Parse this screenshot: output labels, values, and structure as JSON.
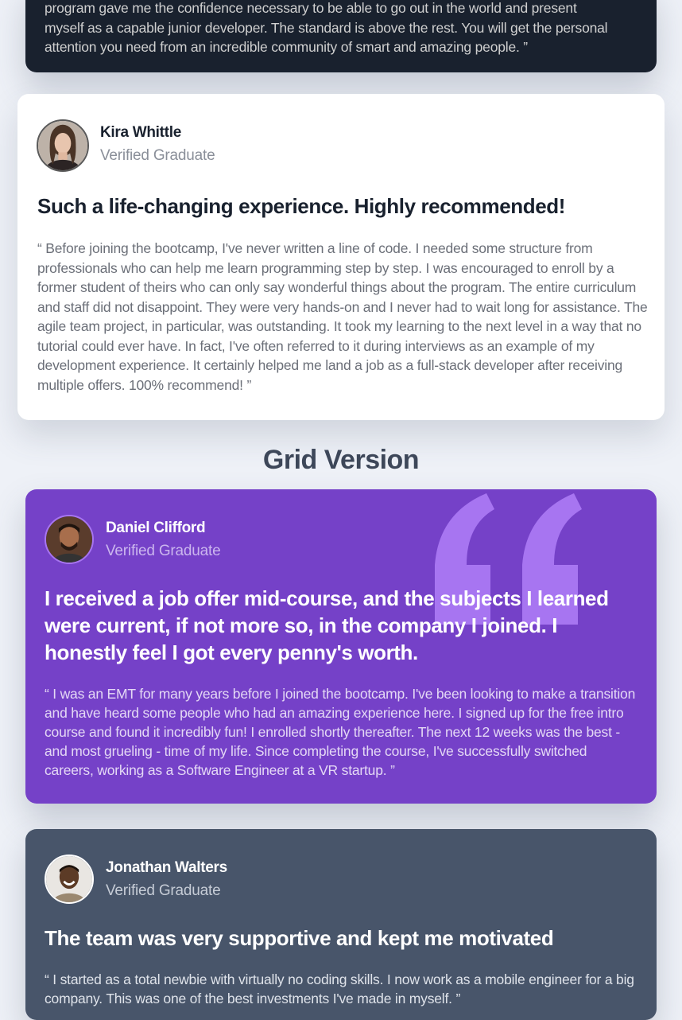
{
  "top_card": {
    "lines": [
      "program gave me the confidence necessary to be able to go out in the world and present",
      "myself as a capable junior developer. The standard is above the rest. You will get the personal",
      "attention you need from an incredible community of smart and amazing people. ”"
    ]
  },
  "kira": {
    "name": "Kira Whittle",
    "role": "Verified Graduate",
    "headline": "Such a life-changing experience. Highly recommended!",
    "quote": "“ Before joining the bootcamp, I've never written a line of code. I needed some structure from professionals who can help me learn programming step by step. I was encouraged to enroll by a former student of theirs who can only say wonderful things about the program. The entire curriculum and staff did not disappoint. They were very hands-on and I never had to wait long for assistance. The agile team project, in particular, was outstanding. It took my learning to the next level in a way that no tutorial could ever have. In fact, I've often referred to it during interviews as an example of my development experience. It certainly helped me land a job as a full-stack developer after receiving multiple offers. 100% recommend! ”"
  },
  "section": {
    "title": "Grid Version"
  },
  "daniel": {
    "name": "Daniel Clifford",
    "role": "Verified Graduate",
    "headline": "I received a job offer mid-course, and the subjects I learned were current, if not more so, in the company I joined. I honestly feel I got every penny's worth.",
    "quote": "“ I was an EMT for many years before I joined the bootcamp. I've been looking to make a transition and have heard some people who had an amazing experience here. I signed up for the free intro course and found it incredibly fun! I enrolled shortly thereafter. The next 12 weeks was the best - and most grueling - time of my life. Since completing the course, I've successfully switched careers, working as a Software Engineer at a VR startup. ”"
  },
  "jonathan": {
    "name": "Jonathan Walters",
    "role": "Verified Graduate",
    "headline": "The team was very supportive and kept me motivated",
    "quote": "“ I started as a total newbie with virtually no coding skills. I now work as a mobile engineer for a big company. This was one of the best investments I've made in myself. ”"
  },
  "colors": {
    "purple": "#7541c8",
    "dark": "#19212e",
    "slate": "#48556a",
    "quote_mark": "#a775f1",
    "background": "#eef1f7"
  },
  "icons": {
    "quote_mark": "quotation-mark-icon"
  }
}
